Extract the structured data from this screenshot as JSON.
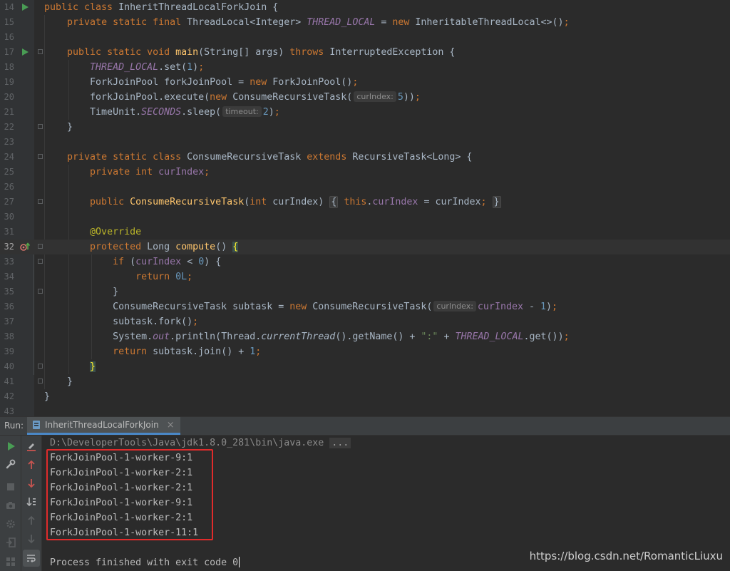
{
  "editor": {
    "lines": [
      {
        "num": "14",
        "row": 0
      },
      {
        "num": "15",
        "row": 1
      },
      {
        "num": "16",
        "row": 2
      },
      {
        "num": "17",
        "row": 3
      },
      {
        "num": "18",
        "row": 4
      },
      {
        "num": "19",
        "row": 5
      },
      {
        "num": "20",
        "row": 6
      },
      {
        "num": "21",
        "row": 7
      },
      {
        "num": "22",
        "row": 8
      },
      {
        "num": "23",
        "row": 9
      },
      {
        "num": "24",
        "row": 10
      },
      {
        "num": "25",
        "row": 11
      },
      {
        "num": "26",
        "row": 12
      },
      {
        "num": "27",
        "row": 13
      },
      {
        "num": "30",
        "row": 14
      },
      {
        "num": "31",
        "row": 15
      },
      {
        "num": "32",
        "row": 16
      },
      {
        "num": "33",
        "row": 17
      },
      {
        "num": "34",
        "row": 18
      },
      {
        "num": "35",
        "row": 19
      },
      {
        "num": "36",
        "row": 20
      },
      {
        "num": "37",
        "row": 21
      },
      {
        "num": "38",
        "row": 22
      },
      {
        "num": "39",
        "row": 23
      },
      {
        "num": "40",
        "row": 24
      },
      {
        "num": "41",
        "row": 25
      },
      {
        "num": "42",
        "row": 26
      },
      {
        "num": "43",
        "row": 27
      }
    ],
    "current_line": "32",
    "hints": {
      "curIndex": "curIndex:",
      "timeout": "timeout:"
    }
  },
  "run_panel": {
    "label": "Run:",
    "tab_label": "InheritThreadLocalForkJoin",
    "tab_close": "×",
    "command": "D:\\DeveloperTools\\Java\\jdk1.8.0_281\\bin\\java.exe",
    "command_ellipsis": "...",
    "output": [
      "ForkJoinPool-1-worker-9:1",
      "ForkJoinPool-1-worker-2:1",
      "ForkJoinPool-1-worker-2:1",
      "ForkJoinPool-1-worker-9:1",
      "ForkJoinPool-1-worker-2:1",
      "ForkJoinPool-1-worker-11:1"
    ],
    "exit_message": "Process finished with exit code 0"
  },
  "watermark": "https://blog.csdn.net/RomanticLiuxu",
  "colors": {
    "background": "#2b2b2b",
    "keyword": "#cc7832",
    "method": "#ffc66d",
    "number": "#6897bb",
    "field": "#9876aa",
    "highlight_box": "#e02b2b",
    "run_icon": "#499c54"
  }
}
